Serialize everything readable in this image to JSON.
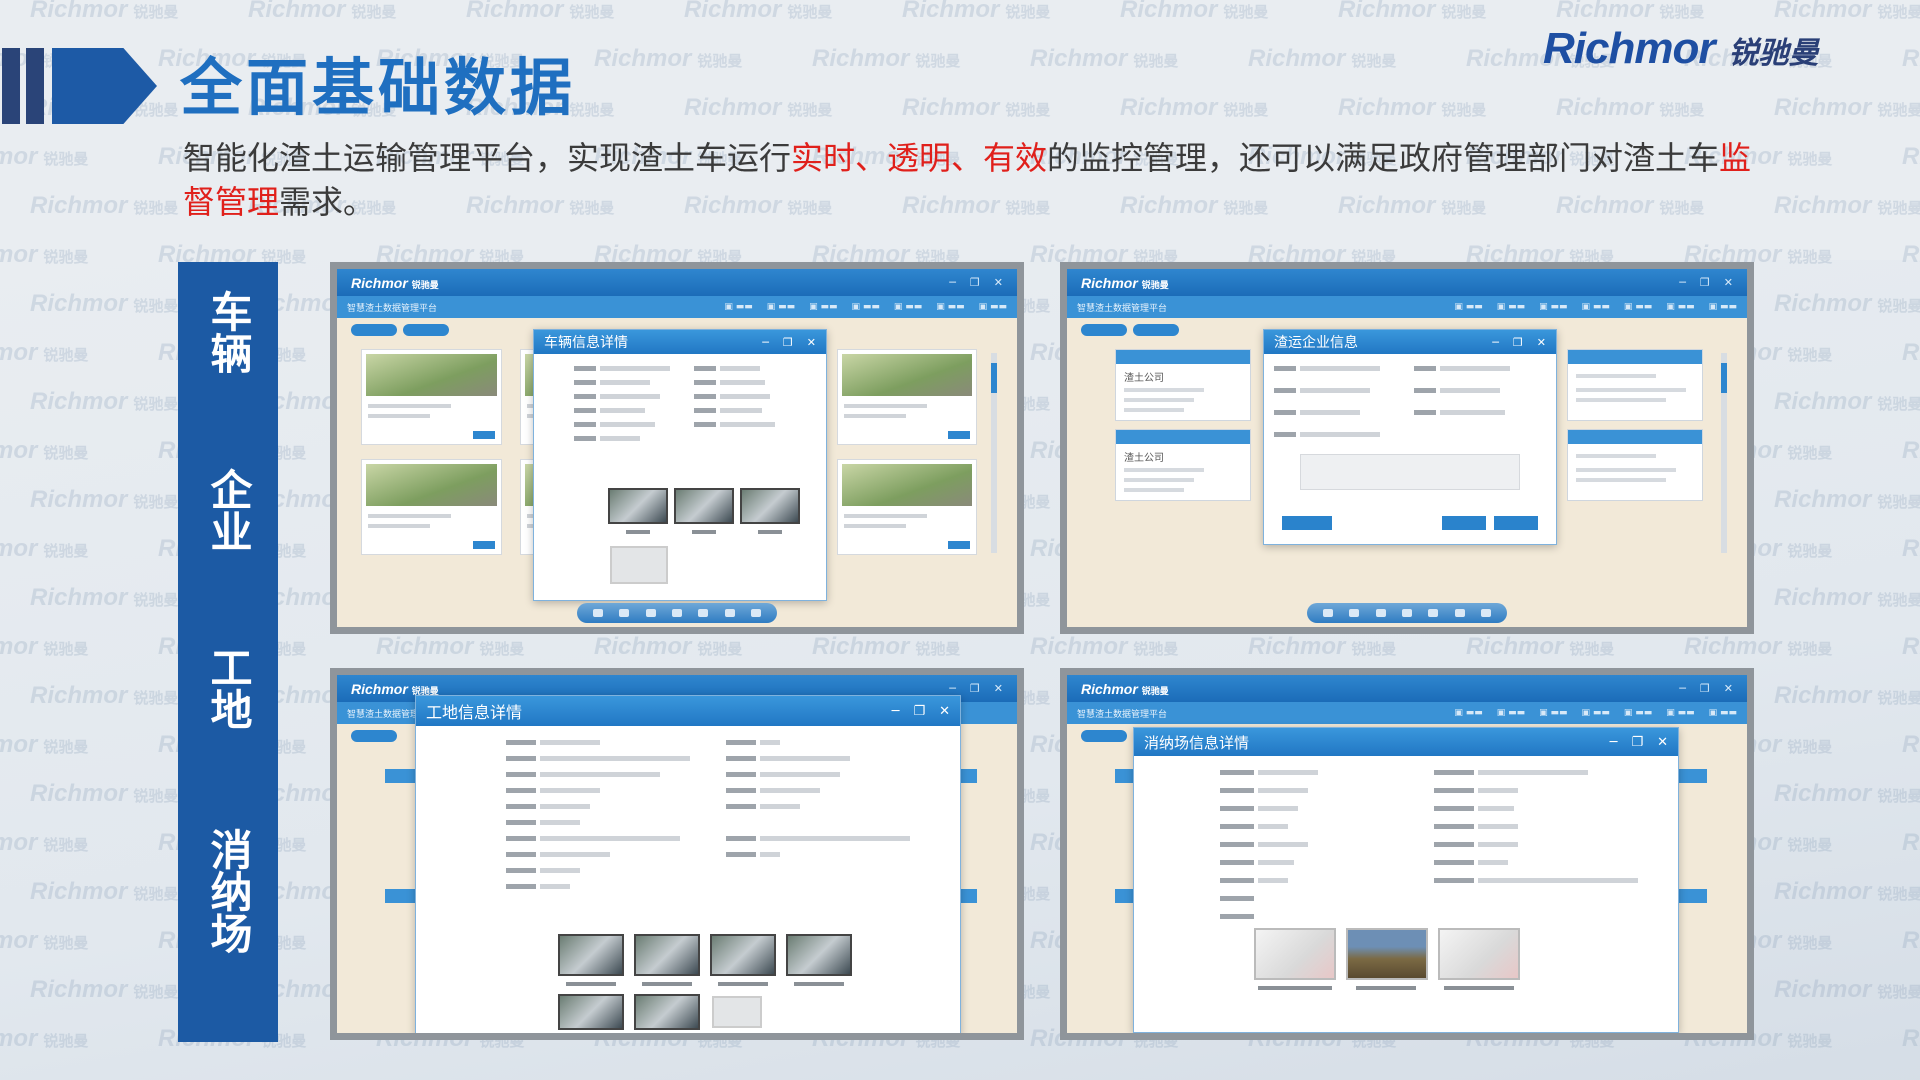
{
  "header": {
    "title": "全面基础数据",
    "brand_en": "Richmor",
    "brand_cn": "锐驰曼"
  },
  "intro": {
    "part1": "智能化渣土运输管理平台，实现渣土车运行",
    "red1": "实时、透明、有效",
    "part2": "的监控管理，还可以满足政府管理部门对渣土车",
    "red2": "监督管理",
    "part3": "需求。"
  },
  "categories": [
    "车辆",
    "企业",
    "工地",
    "消纳场"
  ],
  "watermark": {
    "en": "Richmor",
    "cn": "锐驰曼"
  },
  "panels": {
    "app_logo": "Richmor",
    "app_logo_cn": "锐驰曼",
    "app_subtitle": "智慧渣土数据管理平台",
    "vehicle_dialog_title": "车辆信息详情",
    "enterprise_dialog_title": "渣运企业信息",
    "site_dialog_title": "工地信息详情",
    "disposal_dialog_title": "消纳场信息详情",
    "enterprise_names": [
      "渣土公司",
      "渣土公司"
    ]
  },
  "colors": {
    "title_blue": "#1f6fc0",
    "accent_red": "#e0201b",
    "label_bar": "#1c5aa4",
    "brand_blue": "#1e4fa3"
  }
}
